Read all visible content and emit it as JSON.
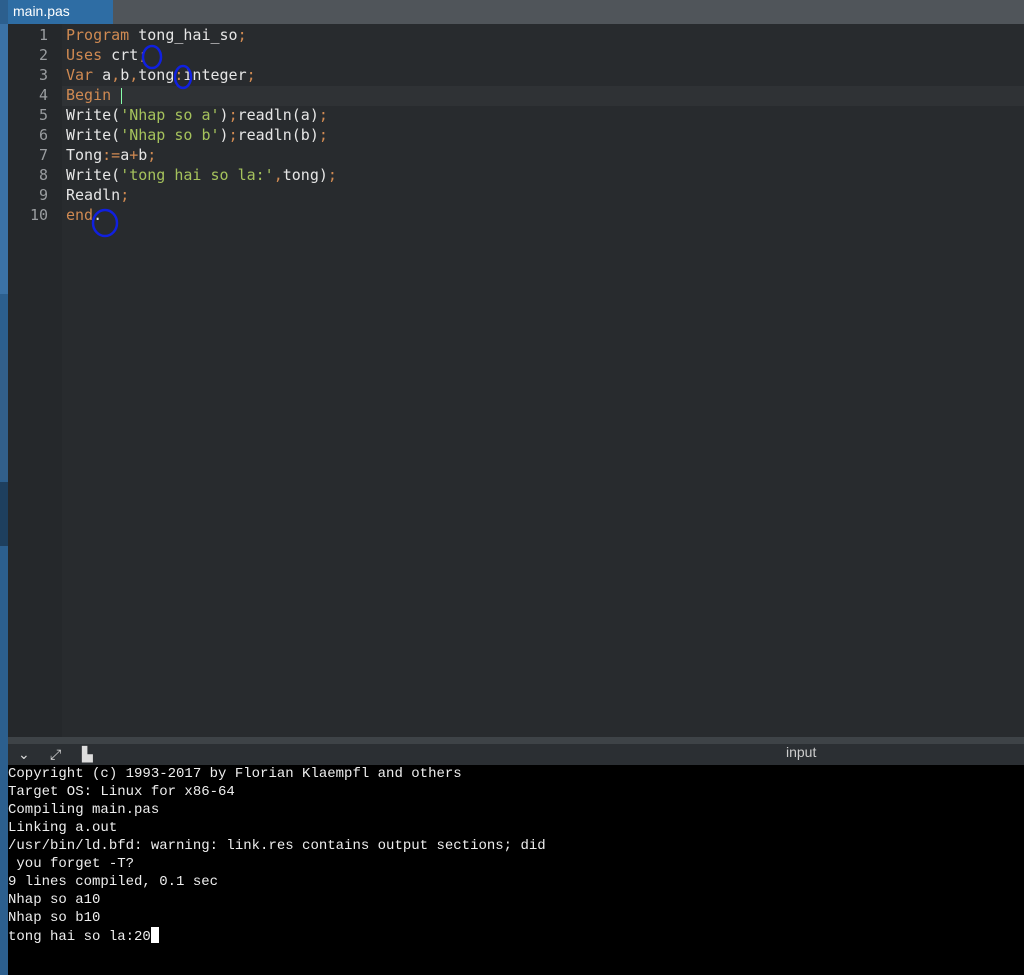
{
  "tab": {
    "label": "main.pas"
  },
  "code": [
    [
      [
        "Program ",
        "kw"
      ],
      [
        "tong_hai_so",
        "id"
      ],
      [
        ";",
        "pn"
      ]
    ],
    [
      [
        "Uses ",
        "kw"
      ],
      [
        "crt",
        "id"
      ],
      [
        ";",
        "pn"
      ]
    ],
    [
      [
        "Var ",
        "kw"
      ],
      [
        "a",
        "id"
      ],
      [
        ",",
        "pn"
      ],
      [
        "b",
        "id"
      ],
      [
        ",",
        "pn"
      ],
      [
        "tong",
        "id"
      ],
      [
        ":",
        "pn"
      ],
      [
        "integer",
        "id"
      ],
      [
        ";",
        "pn"
      ]
    ],
    [
      [
        "Begin",
        "kw"
      ]
    ],
    [
      [
        "Write(",
        "id"
      ],
      [
        "'Nhap so a'",
        "str"
      ],
      [
        ")",
        "id"
      ],
      [
        ";",
        "pn"
      ],
      [
        "readln(a)",
        "id"
      ],
      [
        ";",
        "pn"
      ]
    ],
    [
      [
        "Write(",
        "id"
      ],
      [
        "'Nhap so b'",
        "str"
      ],
      [
        ")",
        "id"
      ],
      [
        ";",
        "pn"
      ],
      [
        "readln(b)",
        "id"
      ],
      [
        ";",
        "pn"
      ]
    ],
    [
      [
        "Tong",
        "id"
      ],
      [
        ":=",
        "pn"
      ],
      [
        "a",
        "id"
      ],
      [
        "+",
        "pn"
      ],
      [
        "b",
        "id"
      ],
      [
        ";",
        "pn"
      ]
    ],
    [
      [
        "Write(",
        "id"
      ],
      [
        "'tong hai so la:'",
        "str"
      ],
      [
        ",",
        "pn"
      ],
      [
        "tong)",
        "id"
      ],
      [
        ";",
        "pn"
      ]
    ],
    [
      [
        "Readln",
        "id"
      ],
      [
        ";",
        "pn"
      ]
    ],
    [
      [
        "end",
        "kw"
      ],
      [
        ".",
        "id"
      ]
    ]
  ],
  "toolbar": {
    "input_label": "input"
  },
  "terminal": {
    "lines": [
      "Copyright (c) 1993-2017 by Florian Klaempfl and others",
      "Target OS: Linux for x86-64",
      "Compiling main.pas",
      "Linking a.out",
      "/usr/bin/ld.bfd: warning: link.res contains output sections; did",
      " you forget -T?",
      "9 lines compiled, 0.1 sec",
      "Nhap so a10",
      "Nhap so b10",
      "tong hai so la:20"
    ]
  }
}
